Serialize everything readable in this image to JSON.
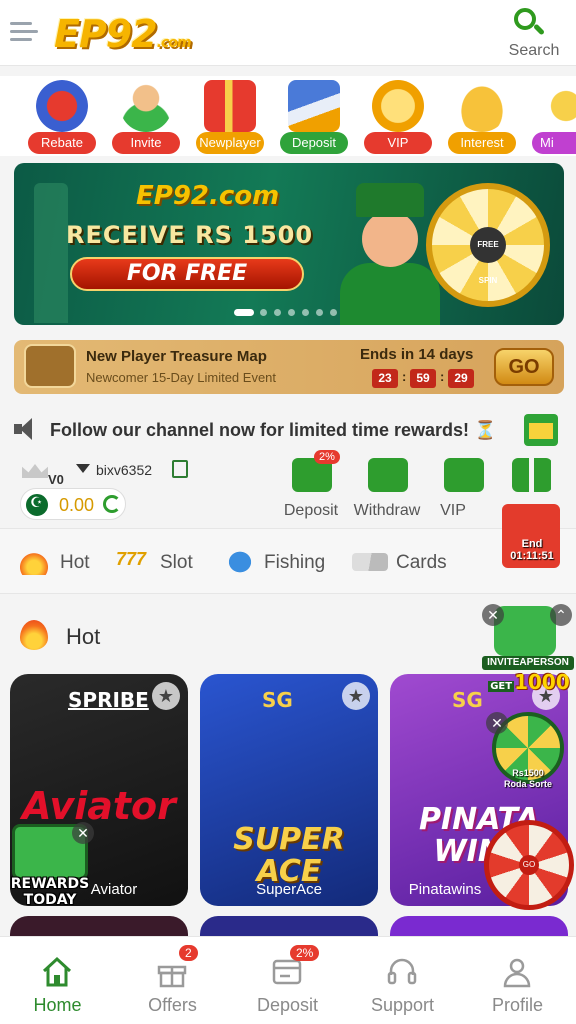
{
  "header": {
    "logo_text": "EP92",
    "logo_suffix": ".com",
    "search_label": "Search"
  },
  "quick_icons": [
    {
      "label": "Rebate",
      "color": "#e63a2e",
      "icon": "casino-chips-icon"
    },
    {
      "label": "Invite",
      "color": "#e63a2e",
      "icon": "people-icon"
    },
    {
      "label": "Newplayer",
      "color": "#f0a000",
      "icon": "gift-boxes-icon"
    },
    {
      "label": "Deposit",
      "color": "#2fa33a",
      "icon": "wallet-cards-icon"
    },
    {
      "label": "VIP",
      "color": "#e63a2e",
      "icon": "vip-badge-icon"
    },
    {
      "label": "Interest",
      "color": "#f0a000",
      "icon": "piggy-bank-icon"
    },
    {
      "label": "Mi",
      "color": "#c040d0",
      "icon": "mission-icon"
    }
  ],
  "banner": {
    "logo_text": "EP92.com",
    "title": "RECEIVE RS 1500",
    "button_label": "FOR FREE",
    "wheel_hub_label": "FREE SPIN",
    "slide_count": 7,
    "active_slide": 1
  },
  "treasure": {
    "title": "New Player Treasure Map",
    "subtitle": "Newcomer 15-Day Limited Event",
    "ends_label": "Ends in 14 days",
    "timer_h": "23",
    "timer_m": "59",
    "timer_s": "29",
    "go_label": "GO"
  },
  "marquee": {
    "text": "Follow our channel now for limited time rewards! ⏳"
  },
  "account": {
    "vip_level": "V0",
    "username": "bixv6352",
    "balance": "0.00",
    "currency_icon": "pakistan-flag-icon"
  },
  "actions": [
    {
      "label": "Deposit",
      "badge": "2%",
      "icon": "wallet-icon"
    },
    {
      "label": "Withdraw",
      "badge": "",
      "icon": "cash-icon"
    },
    {
      "label": "VIP",
      "badge": "",
      "icon": "vip-shield-icon"
    },
    {
      "label": "",
      "badge": "",
      "icon": "apps-grid-icon"
    }
  ],
  "categories": [
    {
      "label": "Hot",
      "icon": "flame-icon"
    },
    {
      "label": "Slot",
      "icon": "slot-777-icon"
    },
    {
      "label": "Fishing",
      "icon": "fish-icon"
    },
    {
      "label": "Cards",
      "icon": "cards-icon"
    }
  ],
  "hot_section": {
    "title": "Hot",
    "games": [
      {
        "name": "Aviator",
        "provider": "SPRIBE",
        "art_text": "Aviator",
        "bg": "#1a1a1a"
      },
      {
        "name": "SuperAce",
        "provider": "SG",
        "art_text": "SUPER ACE",
        "bg": "#1c3a9a"
      },
      {
        "name": "Pinatawins",
        "provider": "SG",
        "art_text": "PINATA WINS",
        "bg": "#6a2ad0"
      }
    ]
  },
  "floating": {
    "redpacket_label": "End",
    "redpacket_timer": "01:11:51",
    "invite_tag": "INVITEAPERSON",
    "invite_get": "GET",
    "invite_amount": "1000",
    "roda_amount": "Rs1500",
    "roda_label": "Roda Sorte",
    "spin_hub": "GO",
    "rewards_line1": "REWARDS",
    "rewards_line2": "TODAY"
  },
  "bottom_nav": [
    {
      "label": "Home",
      "icon": "home-icon",
      "active": true,
      "badge": ""
    },
    {
      "label": "Offers",
      "icon": "gift-icon",
      "active": false,
      "badge": "2"
    },
    {
      "label": "Deposit",
      "icon": "deposit-icon",
      "active": false,
      "badge": "2%"
    },
    {
      "label": "Support",
      "icon": "headset-icon",
      "active": false,
      "badge": ""
    },
    {
      "label": "Profile",
      "icon": "user-icon",
      "active": false,
      "badge": ""
    }
  ]
}
